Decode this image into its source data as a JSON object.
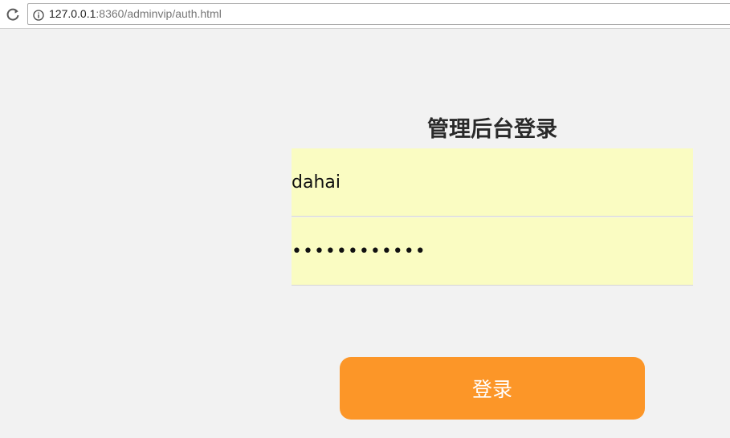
{
  "browser": {
    "url_host": "127.0.0.1",
    "url_rest": ":8360/adminvip/auth.html"
  },
  "login": {
    "title": "管理后台登录",
    "username_value": "dahai",
    "password_value": "••••••••••••",
    "submit_label": "登录"
  },
  "colors": {
    "page_background": "#f2f2f2",
    "field_background": "#fafcc2",
    "button_background": "#fc9628",
    "button_text": "#ffffff"
  },
  "icons": {
    "reload": "reload-icon",
    "info": "info-icon"
  }
}
